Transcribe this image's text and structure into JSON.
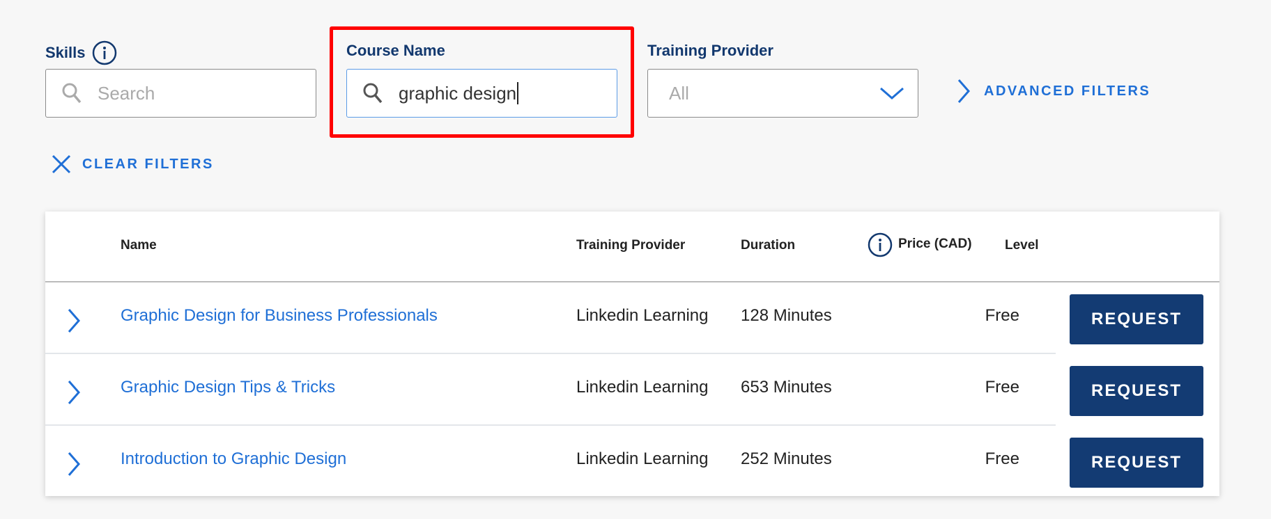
{
  "filters": {
    "skills": {
      "label": "Skills",
      "placeholder": "Search",
      "value": ""
    },
    "course_name": {
      "label": "Course Name",
      "value": "graphic design"
    },
    "training_provider": {
      "label": "Training Provider",
      "value": "All"
    },
    "advanced_filters": "ADVANCED FILTERS",
    "clear_filters": "CLEAR FILTERS"
  },
  "highlight_color": "#ff0000",
  "accent_color": "#1f6fd6",
  "button_color": "#133b73",
  "table": {
    "headers": {
      "name": "Name",
      "provider": "Training Provider",
      "duration": "Duration",
      "price": "Price (CAD)",
      "level": "Level"
    },
    "rows": [
      {
        "name": "Graphic Design for Business Professionals",
        "provider": "Linkedin Learning",
        "duration": "128 Minutes",
        "price": "Free",
        "level": "",
        "action": "REQUEST"
      },
      {
        "name": "Graphic Design Tips & Tricks",
        "provider": "Linkedin Learning",
        "duration": "653 Minutes",
        "price": "Free",
        "level": "",
        "action": "REQUEST"
      },
      {
        "name": "Introduction to Graphic Design",
        "provider": "Linkedin Learning",
        "duration": "252 Minutes",
        "price": "Free",
        "level": "",
        "action": "REQUEST"
      }
    ]
  }
}
